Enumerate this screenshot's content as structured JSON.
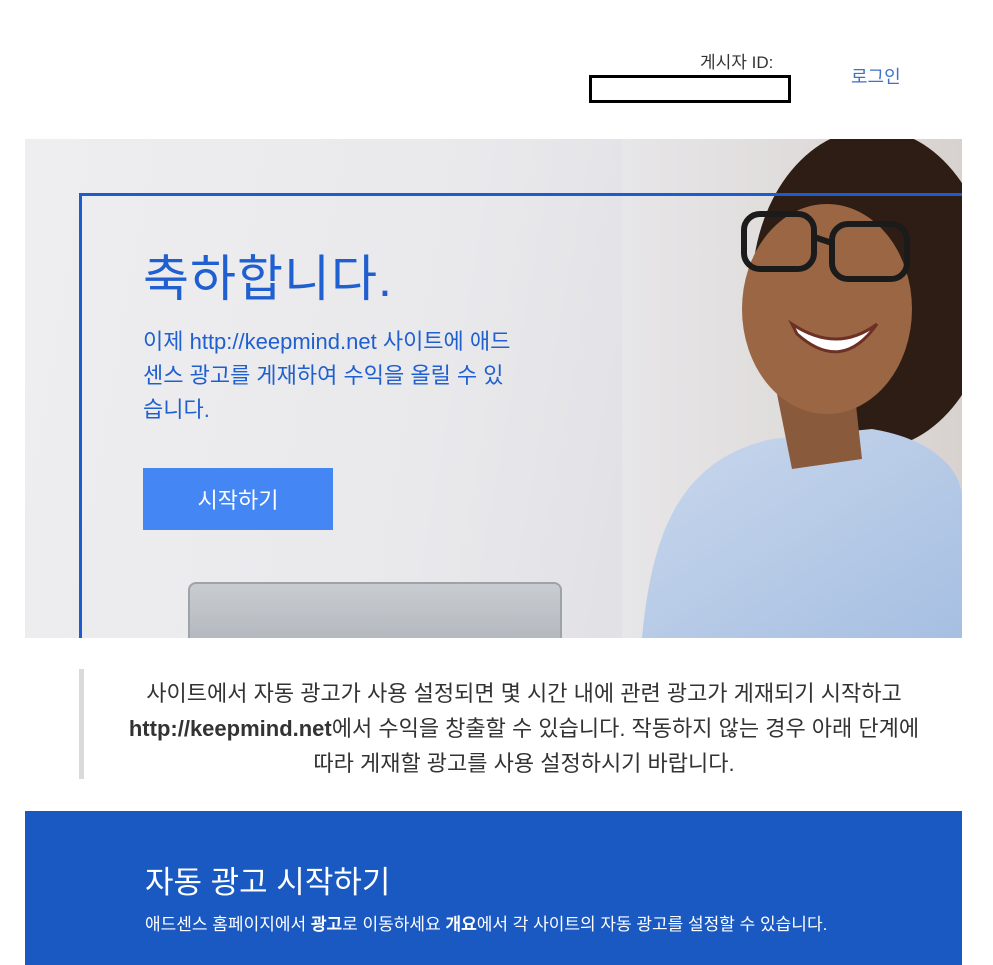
{
  "header": {
    "publisher_label": "게시자 ID:",
    "login_link": "로그인"
  },
  "hero": {
    "title": "축하합니다.",
    "description": "이제 http://keepmind.net 사이트에 애드센스 광고를 게재하여 수익을 올릴 수 있습니다.",
    "start_button": "시작하기",
    "accent_color": "#1f5fcf",
    "button_color": "#4487f4"
  },
  "info": {
    "part1": "사이트에서 자동 광고가 사용 설정되면 몇 시간 내에 관련 광고가 게재되기 시작하고 ",
    "site": "http://keepmind.net",
    "part2": "에서 수익을 창출할 수 있습니다. 작동하지 않는 경우 아래 단계에 따라 게재할 광고를 사용 설정하시기 바랍니다."
  },
  "auto_ads": {
    "title": "자동 광고 시작하기",
    "desc_part1": "애드센스 홈페이지에서 ",
    "desc_bold1": "광고",
    "desc_part2": "로 이동하세요 ",
    "desc_bold2": "개요",
    "desc_part3": "에서 각 사이트의 자동 광고를 설정할 수 있습니다.",
    "background_color": "#1a59c2"
  }
}
